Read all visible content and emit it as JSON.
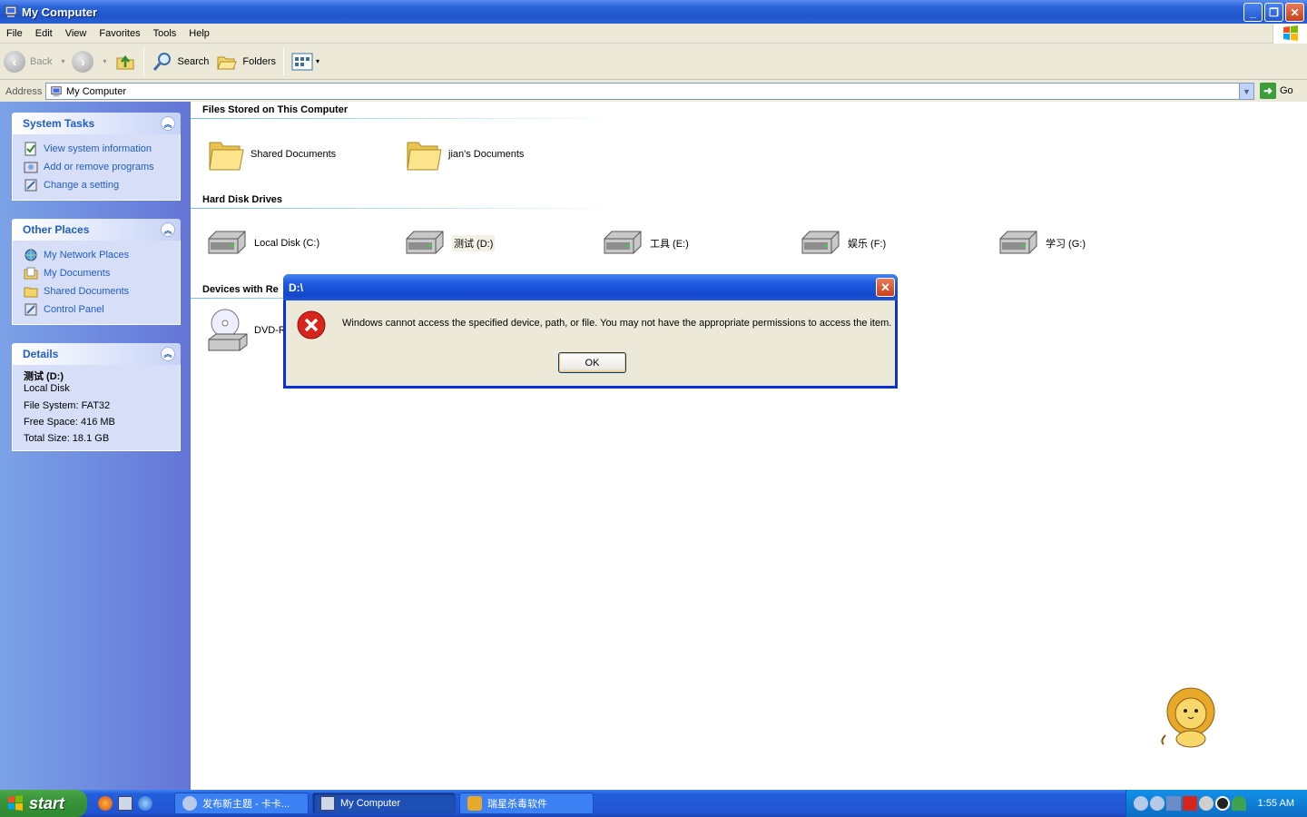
{
  "window": {
    "title": "My Computer"
  },
  "menu": [
    "File",
    "Edit",
    "View",
    "Favorites",
    "Tools",
    "Help"
  ],
  "toolbar": {
    "back": "Back",
    "search": "Search",
    "folders": "Folders"
  },
  "address": {
    "label": "Address",
    "value": "My Computer",
    "go": "Go"
  },
  "system_tasks": {
    "title": "System Tasks",
    "items": [
      "View system information",
      "Add or remove programs",
      "Change a setting"
    ]
  },
  "other_places": {
    "title": "Other Places",
    "items": [
      "My Network Places",
      "My Documents",
      "Shared Documents",
      "Control Panel"
    ]
  },
  "details": {
    "title": "Details",
    "name": "测试 (D:)",
    "type": "Local Disk",
    "fs": "File System: FAT32",
    "free": "Free Space: 416 MB",
    "total": "Total Size: 18.1 GB"
  },
  "sections": {
    "files": "Files Stored on This Computer",
    "drives": "Hard Disk Drives",
    "devices": "Devices with Re"
  },
  "folders": [
    "Shared Documents",
    "jian's Documents"
  ],
  "drives": [
    "Local Disk (C:)",
    "测试 (D:)",
    "工具 (E:)",
    "娱乐 (F:)",
    "学习 (G:)"
  ],
  "devices": [
    "DVD-RA"
  ],
  "dialog": {
    "title": "D:\\",
    "message": "Windows cannot access the specified device, path, or file.  You may not have the appropriate permissions to access the item.",
    "ok": "OK"
  },
  "taskbar": {
    "start": "start",
    "tasks": [
      "发布新主题 - 卡卡...",
      "My Computer",
      "瑞星杀毒软件"
    ],
    "clock": "1:55 AM"
  }
}
